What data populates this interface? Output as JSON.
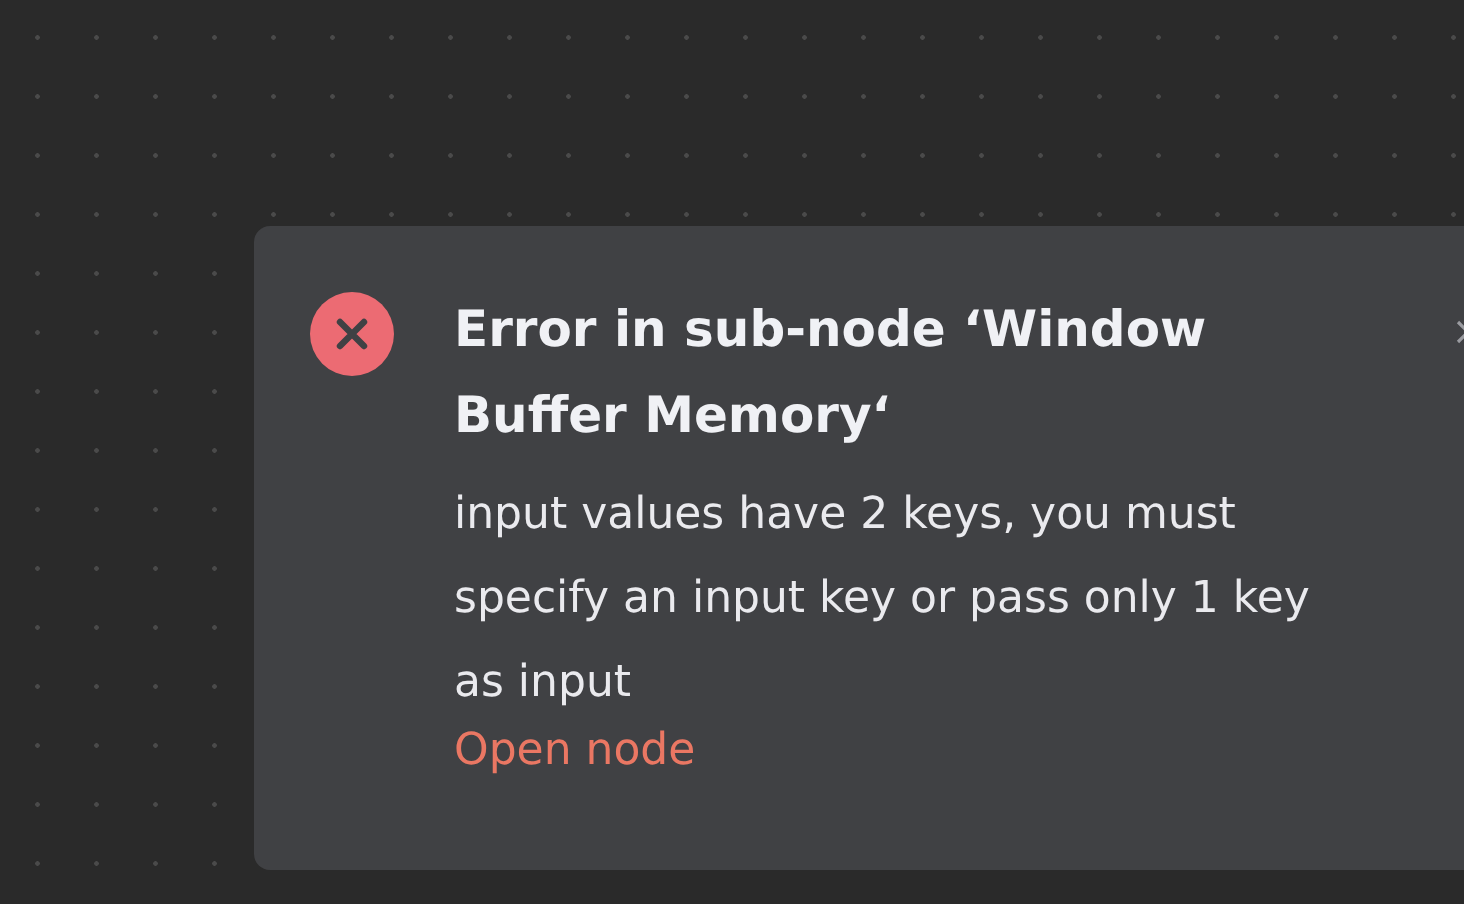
{
  "notification": {
    "kind": "error",
    "title": "Error in sub-node ‘Window Buffer Memory‘",
    "message": "input values have 2 keys, you must specify an input key or pass only 1 key as input",
    "link": "Open node"
  }
}
